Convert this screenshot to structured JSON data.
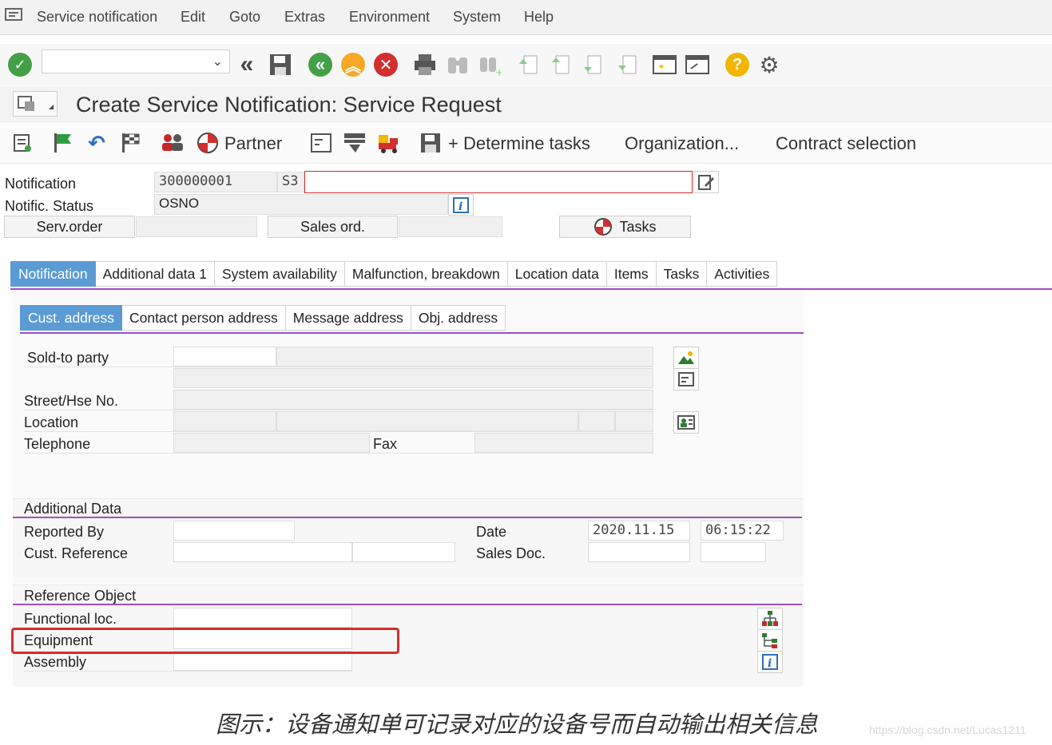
{
  "menubar": {
    "items": [
      "Service notification",
      "Edit",
      "Goto",
      "Extras",
      "Environment",
      "System",
      "Help"
    ]
  },
  "toolbar": {
    "command_field": "",
    "icons": [
      "enter-icon",
      "back-double-icon",
      "save-icon",
      "back-icon",
      "exit-icon",
      "cancel-icon",
      "print-icon",
      "find-icon",
      "find-next-icon",
      "first-page-icon",
      "previous-page-icon",
      "next-page-icon",
      "last-page-icon",
      "create-session-icon",
      "shortcut-icon",
      "help-icon",
      "settings-icon"
    ]
  },
  "title": "Create Service Notification: Service Request",
  "app_toolbar": {
    "partner": "Partner",
    "determine_tasks": "+ Determine tasks",
    "organization": "Organization...",
    "contract_selection": "Contract selection"
  },
  "header": {
    "notification_label": "Notification",
    "notification_number": "300000001",
    "notification_type": "S3",
    "description": "",
    "status_label": "Notific. Status",
    "status_value": "OSNO",
    "serv_order": "Serv.order",
    "sales_ord": "Sales ord.",
    "tasks": "Tasks"
  },
  "tabs": [
    "Notification",
    "Additional data 1",
    "System availability",
    "Malfunction, breakdown",
    "Location data",
    "Items",
    "Tasks",
    "Activities"
  ],
  "subtabs": [
    "Cust. address",
    "Contact person address",
    "Message address",
    "Obj. address"
  ],
  "address": {
    "sold_to_party": "Sold-to party",
    "street": "Street/Hse No.",
    "location": "Location",
    "telephone": "Telephone",
    "fax": "Fax"
  },
  "additional_data": {
    "heading": "Additional Data",
    "reported_by": "Reported By",
    "cust_reference": "Cust. Reference",
    "date_label": "Date",
    "date_value": "2020.11.15",
    "time_value": "06:15:22",
    "sales_doc": "Sales Doc."
  },
  "reference_object": {
    "heading": "Reference Object",
    "functional_loc": "Functional loc.",
    "equipment": "Equipment",
    "assembly": "Assembly"
  },
  "caption": "图示：设备通知单可记录对应的设备号而自动输出相关信息",
  "watermark": "https://blog.csdn.net/Lucas1211",
  "colors": {
    "accent_blue": "#5b9bd5",
    "tab_underline": "#a64ac9",
    "highlight_red": "#d32f2f",
    "enter_green": "#43a047",
    "exit_orange": "#f9a825",
    "cancel_red": "#d32f2f"
  }
}
